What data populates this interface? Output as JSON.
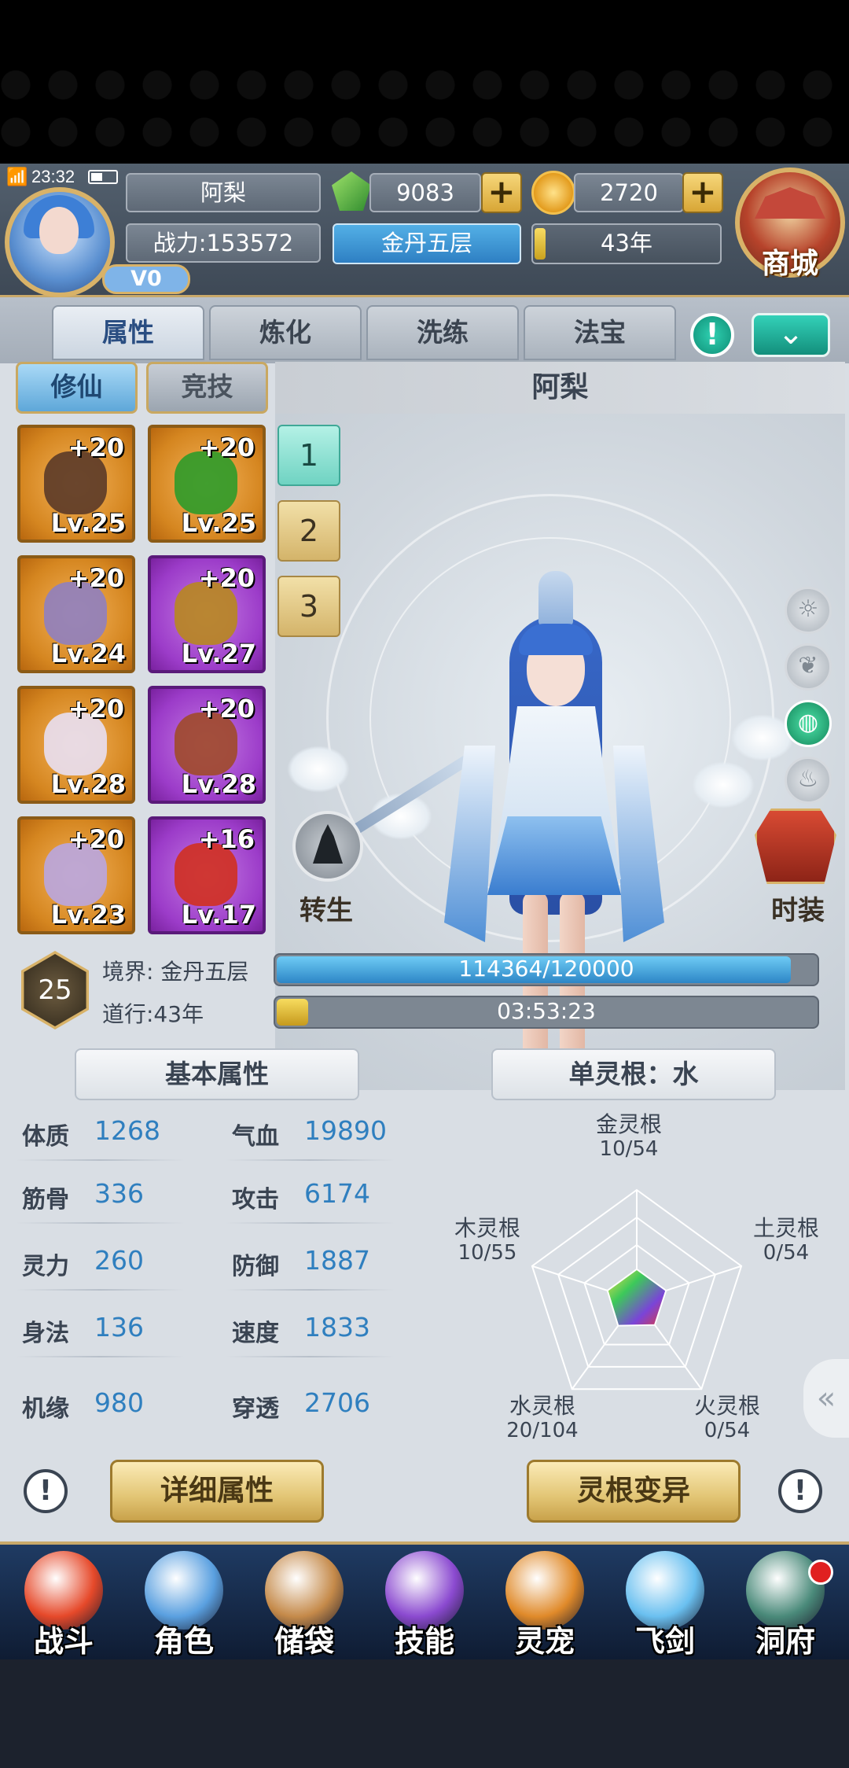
{
  "status": {
    "time": "23:32"
  },
  "player": {
    "name": "阿梨",
    "power": "战力:153572",
    "vip": "V0",
    "realm": "金丹五层",
    "years": "43年"
  },
  "currency": {
    "gems": "9083",
    "coins": "2720"
  },
  "shop": {
    "label": "商城"
  },
  "tabs": [
    "属性",
    "炼化",
    "洗练",
    "法宝"
  ],
  "subtabs": [
    "修仙",
    "竞技"
  ],
  "character": {
    "name": "阿梨",
    "rebirth": "转生",
    "costume": "时装"
  },
  "equipment": [
    {
      "plus": "+20",
      "lv": "Lv.25",
      "rarity": "orange",
      "icon": "bow-icon",
      "color": "#5b3a28"
    },
    {
      "plus": "+20",
      "lv": "Lv.25",
      "rarity": "orange",
      "icon": "jade-ring-icon",
      "color": "#2e9b2a"
    },
    {
      "plus": "+20",
      "lv": "Lv.24",
      "rarity": "orange",
      "icon": "helmet-icon",
      "color": "#8f7fc0"
    },
    {
      "plus": "+20",
      "lv": "Lv.27",
      "rarity": "purple",
      "icon": "dragon-mask-icon",
      "color": "#b8871f"
    },
    {
      "plus": "+20",
      "lv": "Lv.28",
      "rarity": "orange",
      "icon": "shield-icon",
      "color": "#e8dff2"
    },
    {
      "plus": "+20",
      "lv": "Lv.28",
      "rarity": "purple",
      "icon": "dragon-head-icon",
      "color": "#a04a2a"
    },
    {
      "plus": "+20",
      "lv": "Lv.23",
      "rarity": "orange",
      "icon": "star-talisman-icon",
      "color": "#b9a6e0"
    },
    {
      "plus": "+16",
      "lv": "Lv.17",
      "rarity": "purple",
      "icon": "red-orb-necklace-icon",
      "color": "#d03020"
    }
  ],
  "loadouts": [
    "1",
    "2",
    "3"
  ],
  "realm_info": {
    "level": "25",
    "realm_label": "境界: 金丹五层",
    "tao_label": "道行:43年",
    "exp_text": "114364/120000",
    "exp_fraction": 0.953,
    "timer": "03:53:23",
    "tao_fraction": 0.05
  },
  "basic_header": "基本属性",
  "stats": [
    {
      "label": "体质",
      "value": "1268"
    },
    {
      "label": "气血",
      "value": "19890"
    },
    {
      "label": "筋骨",
      "value": "336"
    },
    {
      "label": "攻击",
      "value": "6174"
    },
    {
      "label": "灵力",
      "value": "260"
    },
    {
      "label": "防御",
      "value": "1887"
    },
    {
      "label": "身法",
      "value": "136"
    },
    {
      "label": "速度",
      "value": "1833"
    },
    {
      "label": "机缘",
      "value": "980"
    },
    {
      "label": "穿透",
      "value": "2706"
    }
  ],
  "spirit_root": {
    "header": "单灵根：水",
    "roots": [
      {
        "name": "金灵根",
        "value": "10/54",
        "ratio": 0.185
      },
      {
        "name": "土灵根",
        "value": "0/54",
        "ratio": 0.0
      },
      {
        "name": "火灵根",
        "value": "0/54",
        "ratio": 0.0
      },
      {
        "name": "水灵根",
        "value": "20/104",
        "ratio": 0.192
      },
      {
        "name": "木灵根",
        "value": "10/55",
        "ratio": 0.182
      }
    ]
  },
  "buttons": {
    "detail": "详细属性",
    "mutate": "灵根变异"
  },
  "nav": [
    {
      "label": "战斗",
      "icon": "battle-swirl-icon",
      "color": "#e6492a"
    },
    {
      "label": "角色",
      "icon": "character-portrait-icon",
      "color": "#5aa0e0"
    },
    {
      "label": "储袋",
      "icon": "storage-bag-icon",
      "color": "#c58a4a"
    },
    {
      "label": "技能",
      "icon": "skill-scroll-icon",
      "color": "#8b4ad0"
    },
    {
      "label": "灵宠",
      "icon": "spirit-pet-icon",
      "color": "#e08a2a"
    },
    {
      "label": "飞剑",
      "icon": "flying-sword-icon",
      "color": "#6ac0f0"
    },
    {
      "label": "洞府",
      "icon": "cave-mountain-icon",
      "color": "#4a8a7a"
    }
  ]
}
